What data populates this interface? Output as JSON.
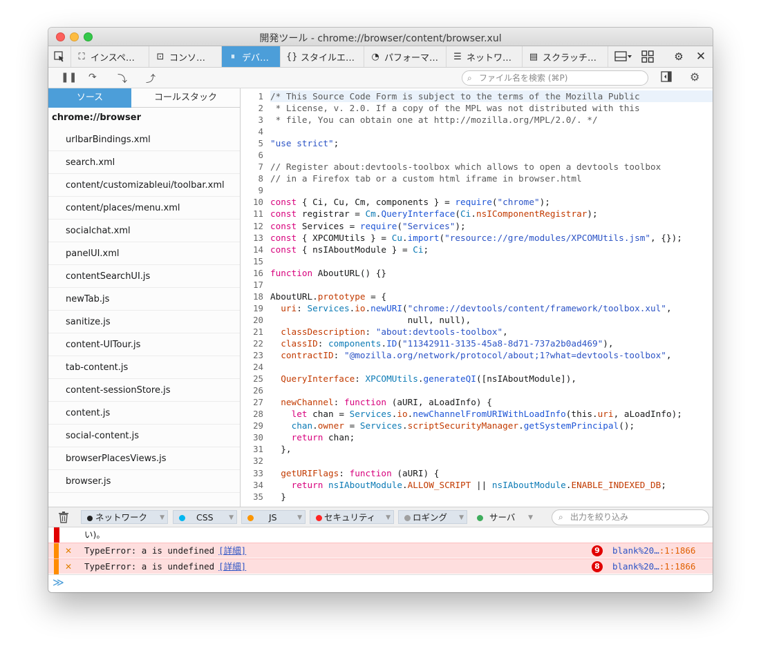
{
  "window": {
    "title": "開発ツール - chrome://browser/content/browser.xul"
  },
  "toolbox": {
    "tabs": [
      {
        "label": "インスペ…",
        "icon": "inspector-icon"
      },
      {
        "label": "コンソ…",
        "icon": "console-icon"
      },
      {
        "label": "デバ…",
        "icon": "debugger-icon"
      },
      {
        "label": "スタイルエ…",
        "icon": "style-editor-icon"
      },
      {
        "label": "パフォーマ…",
        "icon": "performance-icon"
      },
      {
        "label": "ネットワ…",
        "icon": "network-icon"
      },
      {
        "label": "スクラッチ…",
        "icon": "scratchpad-icon"
      }
    ],
    "active_tab": "デバ…"
  },
  "debugger_toolbar": {
    "search_placeholder": "ファイル名を検索 (⌘P)"
  },
  "sidebar": {
    "tabs": [
      "ソース",
      "コールスタック"
    ],
    "group": "chrome://browser",
    "files": [
      "urlbarBindings.xml",
      "search.xml",
      "content/customizableui/toolbar.xml",
      "content/places/menu.xml",
      "socialchat.xml",
      "panelUI.xml",
      "contentSearchUI.js",
      "newTab.js",
      "sanitize.js",
      "content-UITour.js",
      "tab-content.js",
      "content-sessionStore.js",
      "content.js",
      "social-content.js",
      "browserPlacesViews.js",
      "browser.js"
    ]
  },
  "editor": {
    "line_numbers": [
      "1",
      "2",
      "3",
      "4",
      "5",
      "6",
      "7",
      "8",
      "9",
      "10",
      "11",
      "12",
      "13",
      "14",
      "15",
      "16",
      "17",
      "18",
      "19",
      "20",
      "21",
      "22",
      "23",
      "24",
      "25",
      "26",
      "27",
      "28",
      "29",
      "30",
      "31",
      "32",
      "33",
      "34",
      "35"
    ],
    "lines": [
      "/* This Source Code Form is subject to the terms of the Mozilla Public",
      " * License, v. 2.0. If a copy of the MPL was not distributed with this",
      " * file, You can obtain one at http://mozilla.org/MPL/2.0/. */",
      "",
      "\"use strict\";",
      "",
      "// Register about:devtools-toolbox which allows to open a devtools toolbox",
      "// in a Firefox tab or a custom html iframe in browser.html",
      "",
      "const { Ci, Cu, Cm, components } = require(\"chrome\");",
      "const registrar = Cm.QueryInterface(Ci.nsIComponentRegistrar);",
      "const Services = require(\"Services\");",
      "const { XPCOMUtils } = Cu.import(\"resource://gre/modules/XPCOMUtils.jsm\", {});",
      "const { nsIAboutModule } = Ci;",
      "",
      "function AboutURL() {}",
      "",
      "AboutURL.prototype = {",
      "  uri: Services.io.newURI(\"chrome://devtools/content/framework/toolbox.xul\",",
      "                          null, null),",
      "  classDescription: \"about:devtools-toolbox\",",
      "  classID: components.ID(\"11342911-3135-45a8-8d71-737a2b0ad469\"),",
      "  contractID: \"@mozilla.org/network/protocol/about;1?what=devtools-toolbox\",",
      "",
      "  QueryInterface: XPCOMUtils.generateQI([nsIAboutModule]),",
      "",
      "  newChannel: function (aURI, aLoadInfo) {",
      "    let chan = Services.io.newChannelFromURIWithLoadInfo(this.uri, aLoadInfo);",
      "    chan.owner = Services.scriptSecurityManager.getSystemPrincipal();",
      "    return chan;",
      "  },",
      "",
      "  getURIFlags: function (aURI) {",
      "    return nsIAboutModule.ALLOW_SCRIPT || nsIAboutModule.ENABLE_INDEXED_DB;",
      "  }"
    ]
  },
  "console": {
    "filters": [
      {
        "label": "ネットワーク",
        "color": "#222222"
      },
      {
        "label": "CSS",
        "color": "#00b6f0"
      },
      {
        "label": "JS",
        "color": "#fb9500"
      },
      {
        "label": "セキュリティ",
        "color": "#ff2424"
      },
      {
        "label": "ロギング",
        "color": "#a0a0a0"
      },
      {
        "label": "サーバ",
        "color": "#3fad5c"
      }
    ],
    "search_placeholder": "出力を絞り込み",
    "messages": [
      {
        "text": "い)。",
        "kind": "partial"
      },
      {
        "text": "TypeError: a is undefined",
        "detail": "[詳細]",
        "count": "9",
        "source": "blank%20…",
        "loc": ":1:1866"
      },
      {
        "text": "TypeError: a is undefined",
        "detail": "[詳細]",
        "count": "8",
        "source": "blank%20…",
        "loc": ":1:1866"
      }
    ],
    "prompt": "≫"
  },
  "colors": {
    "accent": "#4c9ed9",
    "error_bg": "#fedede",
    "error_badge": "#e10000"
  }
}
